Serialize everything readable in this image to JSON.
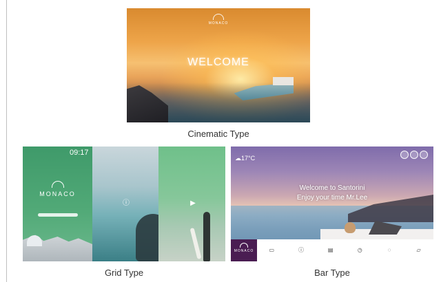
{
  "cinematic": {
    "caption": "Cinematic Type",
    "logo_name": "MONACO",
    "welcome": "WELCOME"
  },
  "grid": {
    "caption": "Grid Type",
    "time": "09:17",
    "logo_name": "MONACO"
  },
  "bar": {
    "caption": "Bar Type",
    "weather": "17°C",
    "welcome_line1": "Welcome to Santorini",
    "welcome_line2": "Enjoy your time Mr.Lee",
    "brand_name": "MONACO",
    "items": [
      {
        "icon": "tv-icon"
      },
      {
        "icon": "info-icon"
      },
      {
        "icon": "bill-icon"
      },
      {
        "icon": "clock-icon"
      },
      {
        "icon": "chat-icon"
      },
      {
        "icon": "cast-icon"
      }
    ]
  }
}
